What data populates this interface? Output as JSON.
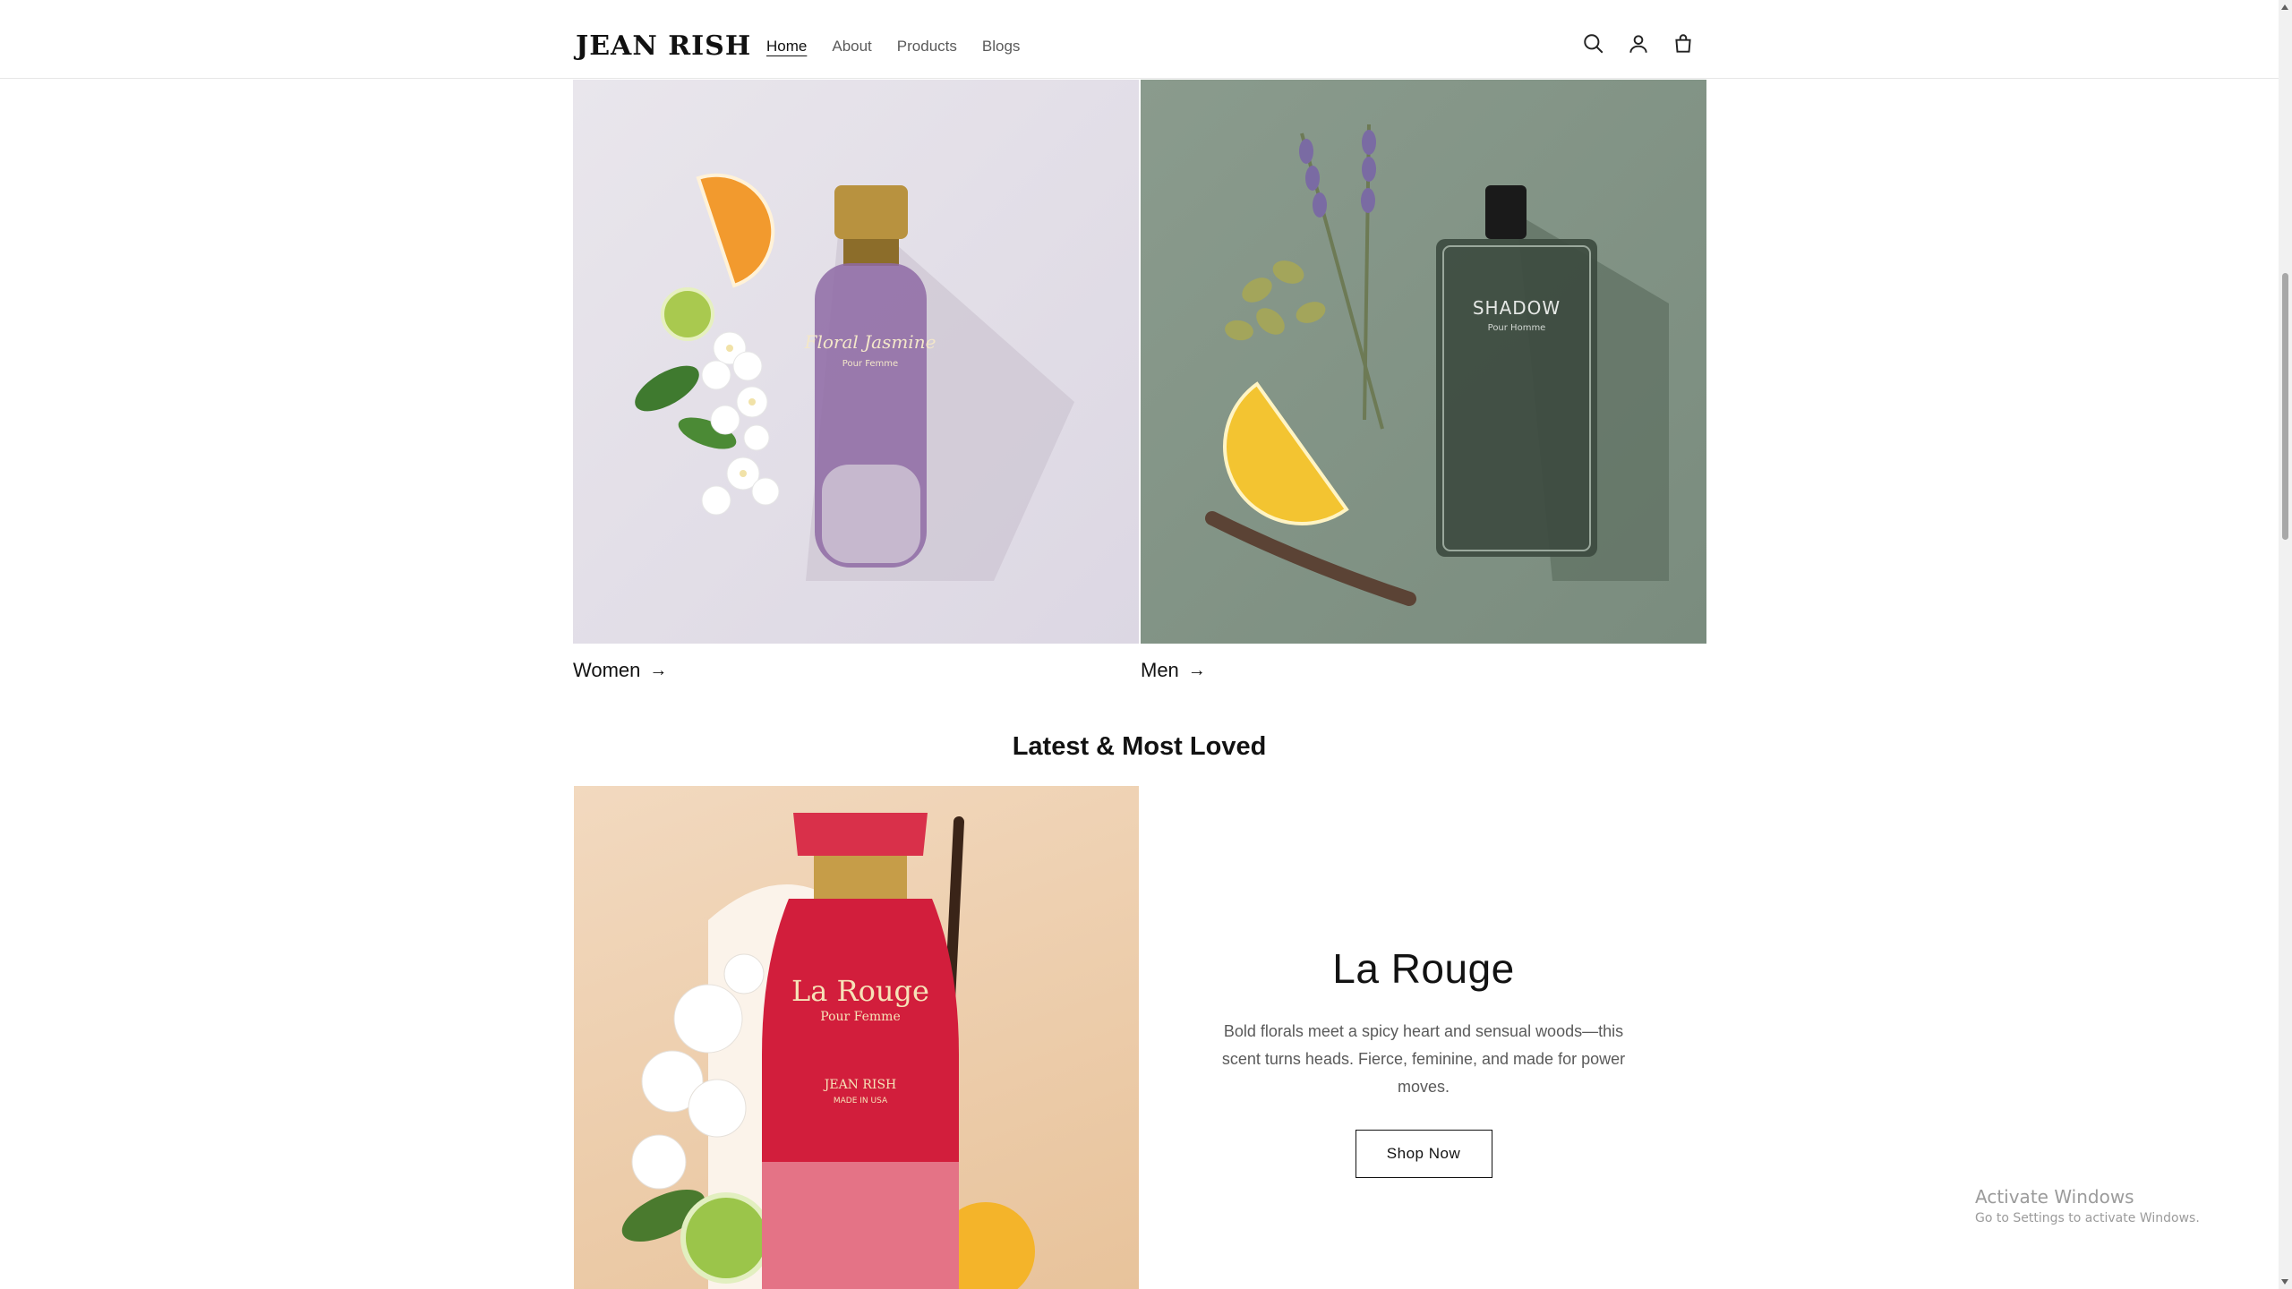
{
  "header": {
    "logo": "JEAN RISH",
    "nav": [
      {
        "label": "Home",
        "active": true
      },
      {
        "label": "About",
        "active": false
      },
      {
        "label": "Products",
        "active": false
      },
      {
        "label": "Blogs",
        "active": false
      }
    ],
    "icons": [
      "search-icon",
      "account-icon",
      "cart-icon"
    ]
  },
  "categories": [
    {
      "label": "Women",
      "arrow": "→",
      "bottle_text": "Floral Jasmine",
      "bottle_sub": "Pour Femme"
    },
    {
      "label": "Men",
      "arrow": "→",
      "bottle_text": "SHADOW",
      "bottle_sub": "Pour Homme"
    }
  ],
  "section": {
    "title": "Latest & Most Loved"
  },
  "feature": {
    "title": "La Rouge",
    "description": "Bold florals meet a spicy heart and sensual woods—this scent turns heads. Fierce, feminine, and made for power moves.",
    "button": "Shop Now",
    "bottle_text": "La Rouge",
    "bottle_sub": "Pour Femme",
    "bottle_brand": "JEAN RISH",
    "bottle_origin": "MADE IN USA"
  },
  "watermark": {
    "line1": "Activate Windows",
    "line2": "Go to Settings to activate Windows."
  },
  "colors": {
    "accent": "#121212",
    "muted_text": "#5a5a5a",
    "women_bg": "#dcd7e3",
    "men_bg": "#7a8c7e",
    "feature_bg": "#e8c39b"
  }
}
